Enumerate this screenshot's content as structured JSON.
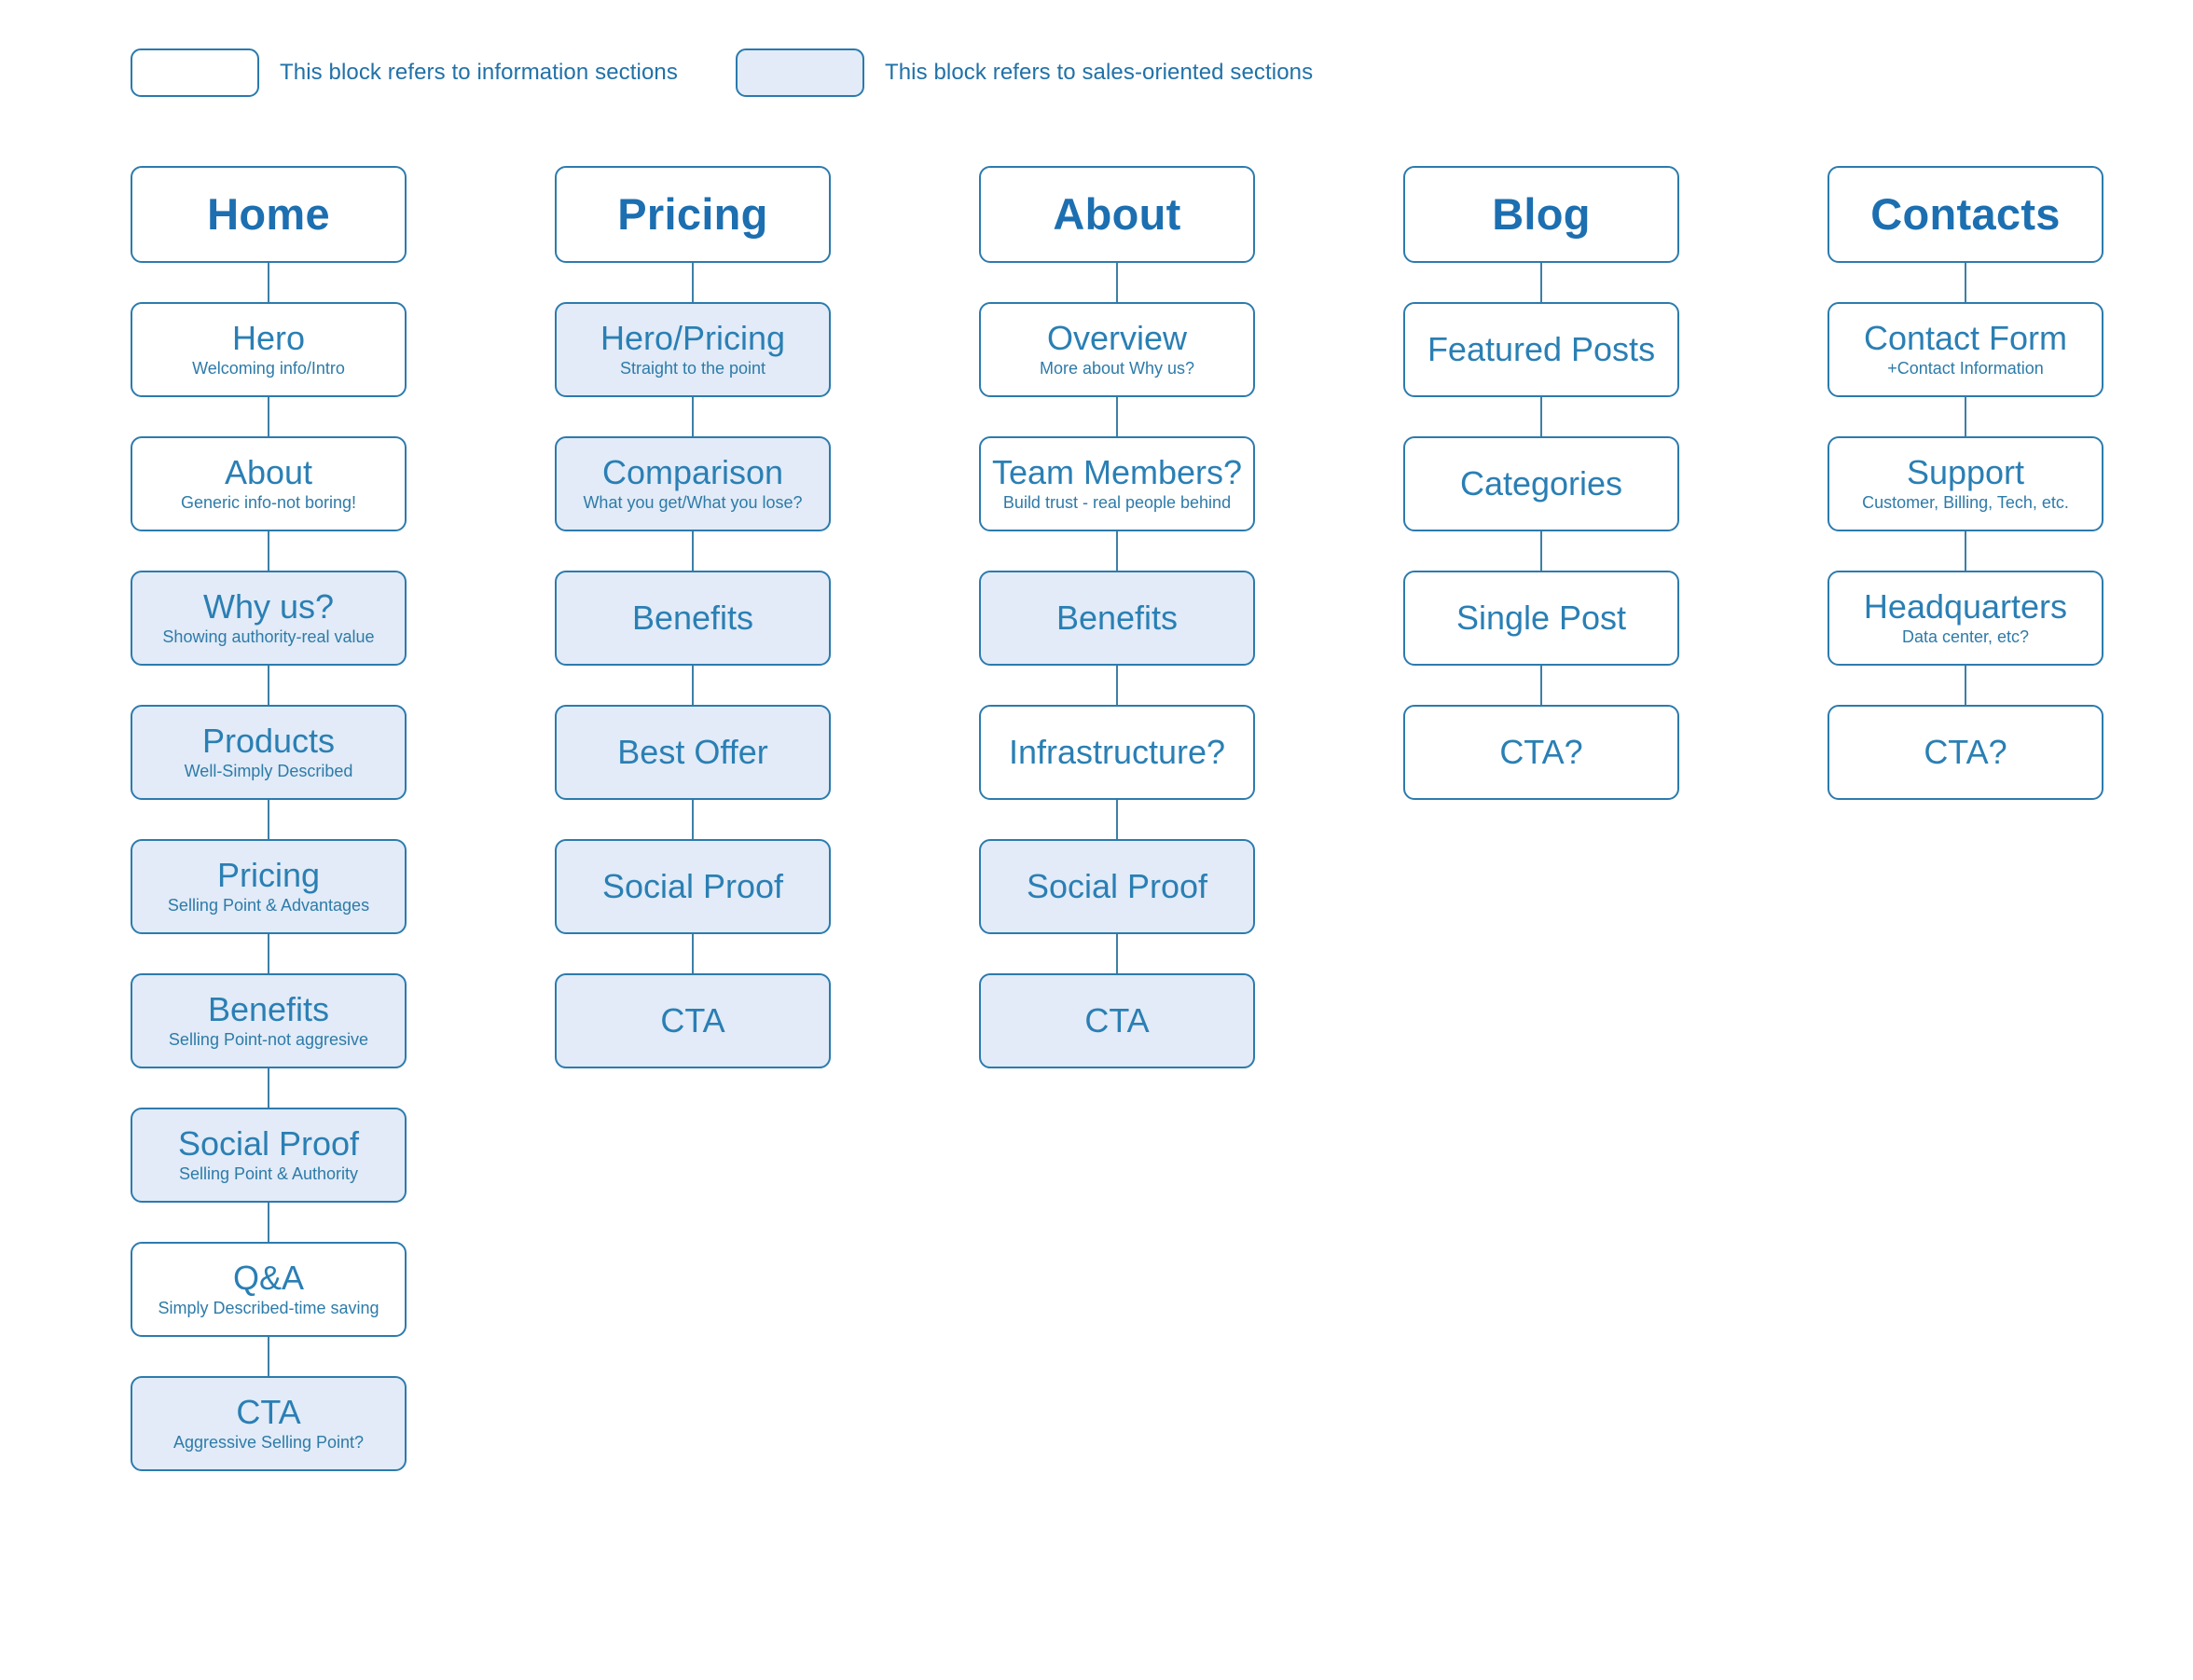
{
  "legend": {
    "items": [
      {
        "swatch": "white",
        "label": "This block refers to information sections"
      },
      {
        "swatch": "sales",
        "label": "This block refers to sales-oriented sections"
      }
    ]
  },
  "columns": [
    {
      "id": "home",
      "header": {
        "title": "Home",
        "type": "info"
      },
      "nodes": [
        {
          "title": "Hero",
          "sub": "Welcoming info/Intro",
          "type": "info"
        },
        {
          "title": "About",
          "sub": "Generic info-not boring!",
          "type": "info"
        },
        {
          "title": "Why us?",
          "sub": "Showing authority-real value",
          "type": "sales"
        },
        {
          "title": "Products",
          "sub": "Well-Simply Described",
          "type": "sales"
        },
        {
          "title": "Pricing",
          "sub": "Selling Point & Advantages",
          "type": "sales"
        },
        {
          "title": "Benefits",
          "sub": "Selling Point-not aggresive",
          "type": "sales"
        },
        {
          "title": "Social Proof",
          "sub": "Selling Point & Authority",
          "type": "sales"
        },
        {
          "title": "Q&A",
          "sub": "Simply Described-time saving",
          "type": "info"
        },
        {
          "title": "CTA",
          "sub": "Aggressive Selling Point?",
          "type": "sales"
        }
      ]
    },
    {
      "id": "pricing",
      "header": {
        "title": "Pricing",
        "type": "info"
      },
      "nodes": [
        {
          "title": "Hero/Pricing",
          "sub": "Straight to the point",
          "type": "sales"
        },
        {
          "title": "Comparison",
          "sub": "What you get/What you lose?",
          "type": "sales"
        },
        {
          "title": "Benefits",
          "sub": "",
          "type": "sales"
        },
        {
          "title": "Best Offer",
          "sub": "",
          "type": "sales"
        },
        {
          "title": "Social Proof",
          "sub": "",
          "type": "sales"
        },
        {
          "title": "CTA",
          "sub": "",
          "type": "sales"
        }
      ]
    },
    {
      "id": "about",
      "header": {
        "title": "About",
        "type": "info"
      },
      "nodes": [
        {
          "title": "Overview",
          "sub": "More about Why us?",
          "type": "info"
        },
        {
          "title": "Team Members?",
          "sub": "Build trust - real people behind",
          "type": "info"
        },
        {
          "title": "Benefits",
          "sub": "",
          "type": "sales"
        },
        {
          "title": "Infrastructure?",
          "sub": "",
          "type": "info"
        },
        {
          "title": "Social Proof",
          "sub": "",
          "type": "sales"
        },
        {
          "title": "CTA",
          "sub": "",
          "type": "sales"
        }
      ]
    },
    {
      "id": "blog",
      "header": {
        "title": "Blog",
        "type": "info"
      },
      "nodes": [
        {
          "title": "Featured Posts",
          "sub": "",
          "type": "info"
        },
        {
          "title": "Categories",
          "sub": "",
          "type": "info"
        },
        {
          "title": "Single Post",
          "sub": "",
          "type": "info"
        },
        {
          "title": "CTA?",
          "sub": "",
          "type": "info"
        }
      ]
    },
    {
      "id": "contacts",
      "header": {
        "title": "Contacts",
        "type": "info"
      },
      "nodes": [
        {
          "title": "Contact Form",
          "sub": "+Contact Information",
          "type": "info"
        },
        {
          "title": "Support",
          "sub": "Customer, Billing, Tech, etc.",
          "type": "info"
        },
        {
          "title": "Headquarters",
          "sub": "Data center, etc?",
          "type": "info"
        },
        {
          "title": "CTA?",
          "sub": "",
          "type": "info"
        }
      ]
    }
  ],
  "colors": {
    "accent": "#1c6fb0",
    "node_text": "#2a7fb4",
    "border": "#2c7bad",
    "sales_fill": "#e2ebf7",
    "info_fill": "#ffffff",
    "connector": "#3d7fa6"
  }
}
